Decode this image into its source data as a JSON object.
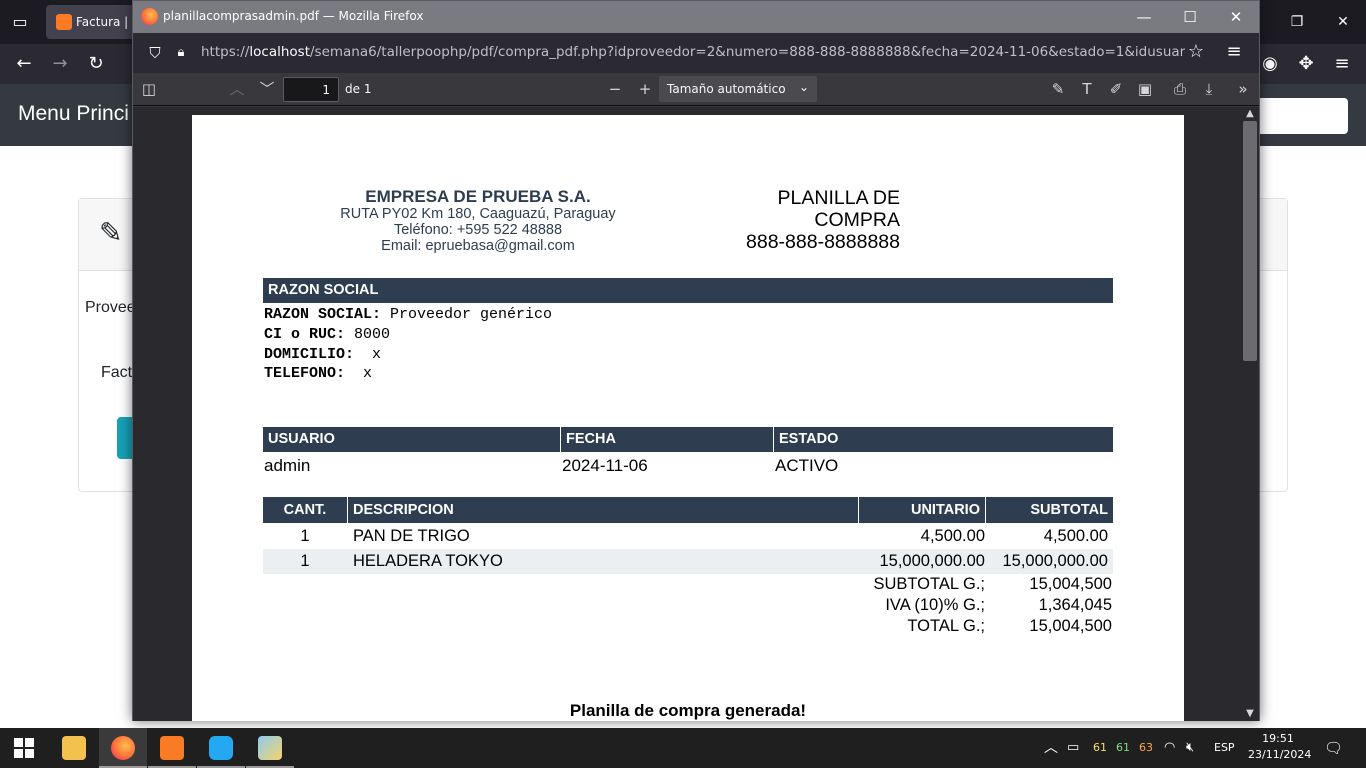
{
  "background_browser": {
    "tab_title": "Factura | C",
    "header_title": "Menu Princi",
    "card": {
      "label_proveedor": "Provee",
      "label_factura": "Fact"
    }
  },
  "pdf_window": {
    "title": "planillacomprasadmin.pdf — Mozilla Firefox",
    "url_prefix": "https://",
    "url_host": "localhost",
    "url_rest": "/semana6/tallerpoophp/pdf/compra_pdf.php?idproveedor=2&numero=888-888-8888888&fecha=2024-11-06&estado=1&idusuario=undefine",
    "page_input": "1",
    "page_of": "de 1",
    "zoom": "Tamaño automático"
  },
  "document": {
    "company": {
      "name": "EMPRESA DE PRUEBA S.A.",
      "address": "RUTA PY02 Km 180, Caaguazú, Paraguay",
      "phone": "Teléfono: +595 522 48888",
      "email": "Email: epruebasa@gmail.com"
    },
    "title_line1": "PLANILLA DE",
    "title_line2": "COMPRA",
    "number": "888-888-8888888",
    "razon_header": "RAZON SOCIAL",
    "razon": {
      "label_razon": "RAZON SOCIAL:",
      "value_razon": " Proveedor genérico",
      "label_ruc": "CI o RUC:",
      "value_ruc": " 8000",
      "label_domicilio": "DOMICILIO:",
      "value_domicilio": "  x",
      "label_telefono": "TELEFONO:",
      "value_telefono": "  x"
    },
    "info_headers": {
      "usuario": "USUARIO",
      "fecha": "FECHA",
      "estado": "ESTADO"
    },
    "info_values": {
      "usuario": "admin",
      "fecha": "2024-11-06",
      "estado": "ACTIVO"
    },
    "items_headers": {
      "cant": "CANT.",
      "descripcion": "DESCRIPCION",
      "unitario": "UNITARIO",
      "subtotal": "SUBTOTAL"
    },
    "items": [
      {
        "cant": "1",
        "descripcion": "PAN DE TRIGO",
        "unitario": "4,500.00",
        "subtotal": "4,500.00"
      },
      {
        "cant": "1",
        "descripcion": "HELADERA TOKYO",
        "unitario": "15,000,000.00",
        "subtotal": "15,000,000.00"
      }
    ],
    "totals": [
      {
        "label": "SUBTOTAL G.;",
        "value": "15,004,500"
      },
      {
        "label": "IVA (10)% G.;",
        "value": "1,364,045"
      },
      {
        "label": "TOTAL G.;",
        "value": "15,004,500"
      }
    ],
    "footer": "Planilla de compra generada!"
  },
  "taskbar": {
    "tray_battery_values": [
      "61",
      "61",
      "63"
    ],
    "language": "ESP",
    "time": "19:51",
    "date": "23/11/2024"
  }
}
